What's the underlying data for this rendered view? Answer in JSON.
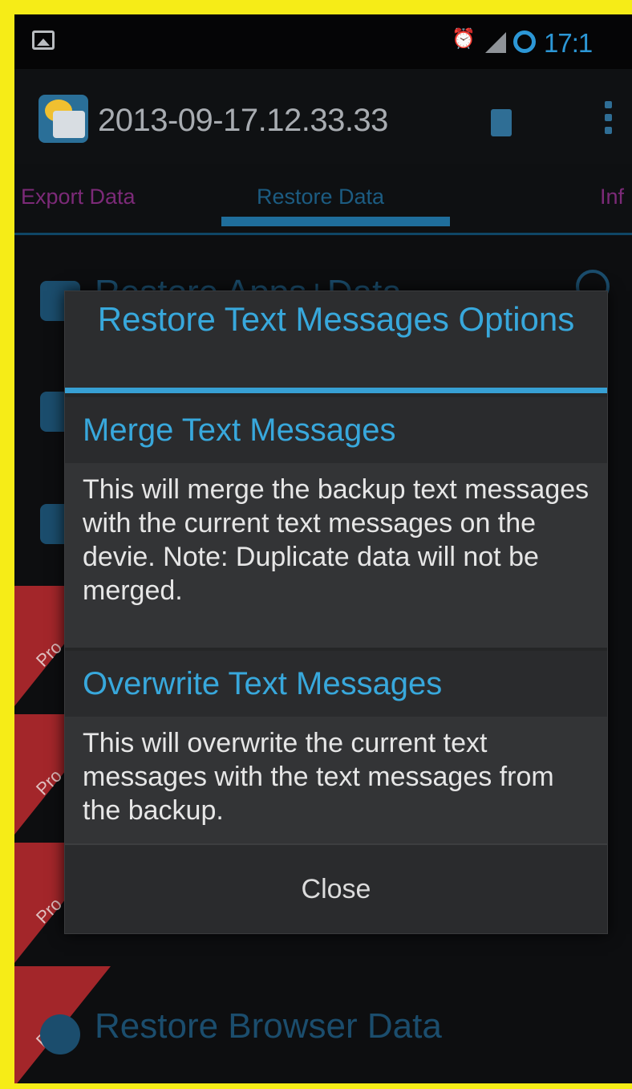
{
  "status_bar": {
    "time": "17:1",
    "icons": [
      "image-icon",
      "alarm-icon",
      "signal-icon",
      "sync-icon"
    ]
  },
  "action_bar": {
    "title": "2013-09-17.12.33.33",
    "icons": [
      "app-icon",
      "delete-icon",
      "overflow-menu-icon"
    ]
  },
  "tabs": [
    {
      "label": "Export Data"
    },
    {
      "label": "Restore Data",
      "selected": true
    },
    {
      "label": "Inf"
    }
  ],
  "background_list": {
    "items": [
      {
        "label": "Restore Apps+Data"
      },
      {
        "label": "Restore Browser Data"
      }
    ],
    "pro_label": "Pro"
  },
  "dialog": {
    "title": "Restore Text Messages Options",
    "options": [
      {
        "header": "Merge Text Messages",
        "body": "This will merge the backup text messages with the current text messages on the devie. Note: Duplicate data will not be merged."
      },
      {
        "header": "Overwrite Text Messages",
        "body": "This will overwrite the current text messages with the text messages from the backup."
      }
    ],
    "close_label": "Close"
  },
  "colors": {
    "accent": "#38a8dc",
    "frame": "#f6ec17",
    "pro_ribbon": "#a3262a"
  }
}
